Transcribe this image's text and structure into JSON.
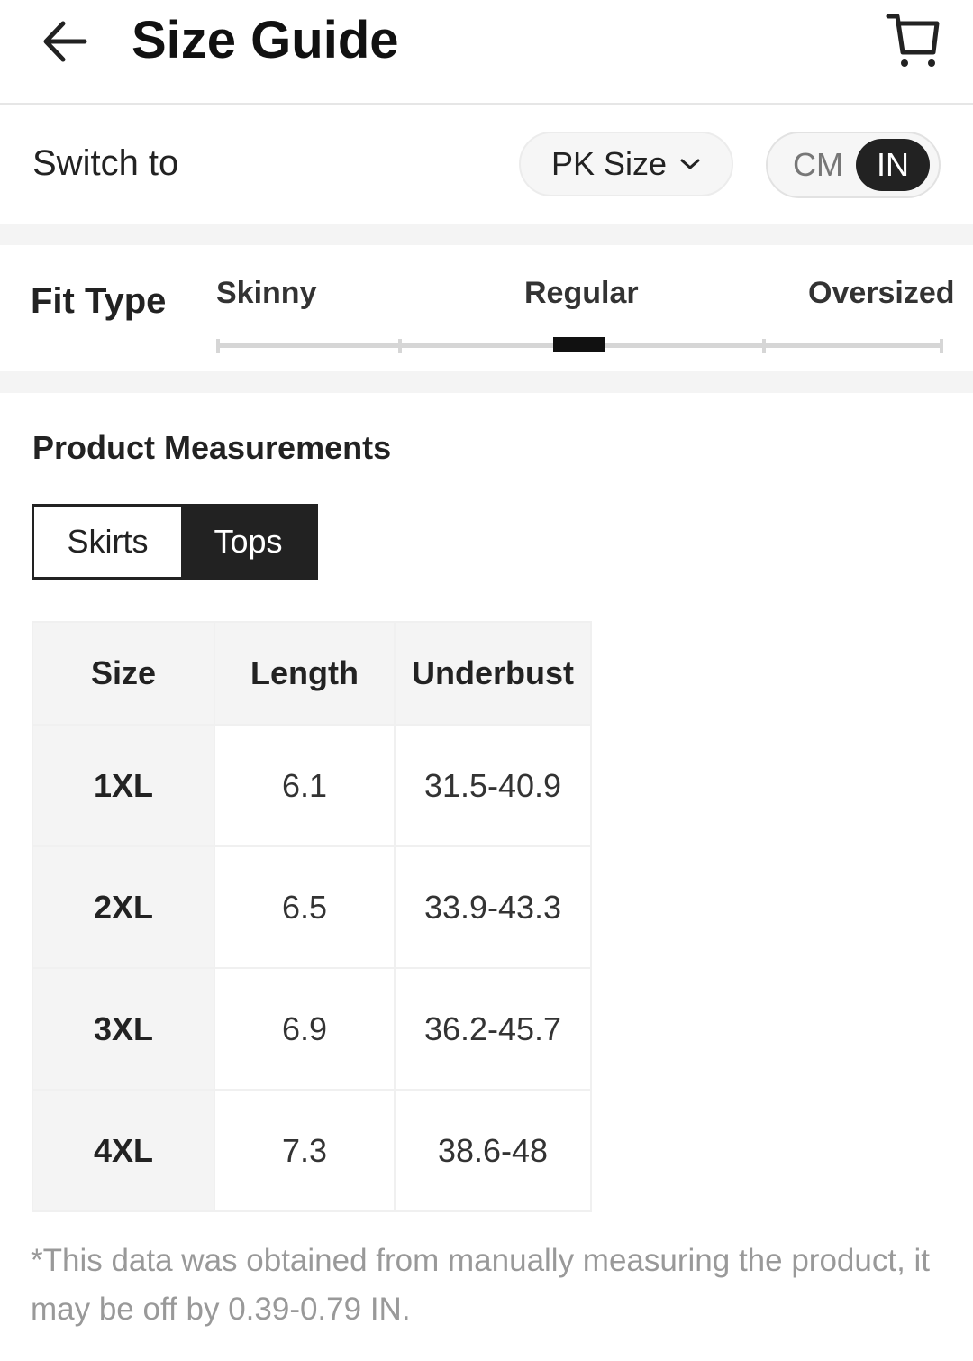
{
  "header": {
    "title": "Size Guide",
    "back_icon": "arrow-left-icon",
    "cart_icon": "cart-icon"
  },
  "switch": {
    "label": "Switch to",
    "size_system": "PK Size",
    "unit_options": [
      "CM",
      "IN"
    ],
    "selected_unit": "IN"
  },
  "fit": {
    "title": "Fit Type",
    "options": [
      "Skinny",
      "Regular",
      "Oversized"
    ],
    "selected": "Regular"
  },
  "measurements": {
    "title": "Product Measurements",
    "tabs": [
      "Skirts",
      "Tops"
    ],
    "selected_tab": "Tops",
    "table": {
      "headers": [
        "Size",
        "Length",
        "Underbust"
      ],
      "rows": [
        [
          "1XL",
          "6.1",
          "31.5-40.9"
        ],
        [
          "2XL",
          "6.5",
          "33.9-43.3"
        ],
        [
          "3XL",
          "6.9",
          "36.2-45.7"
        ],
        [
          "4XL",
          "7.3",
          "38.6-48"
        ]
      ]
    },
    "note": "*This data was obtained from manually measuring the product, it may be off by 0.39-0.79 IN."
  },
  "colors": {
    "accent": "#222222",
    "muted_text": "#999999",
    "band": "#f4f4f4"
  }
}
